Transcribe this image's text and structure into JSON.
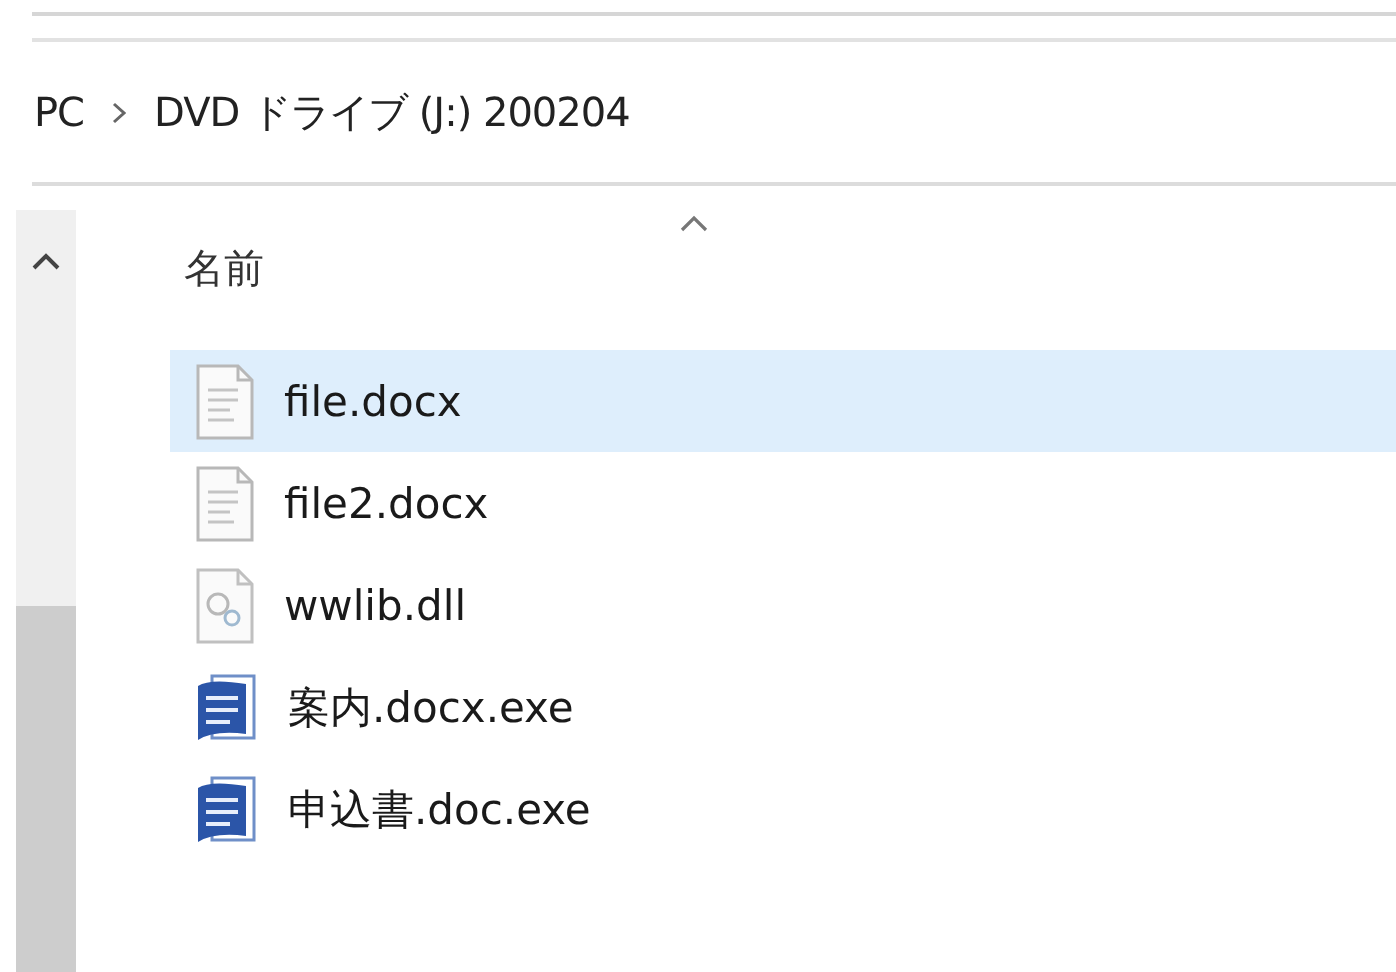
{
  "breadcrumb": [
    "PC",
    "DVD ドライブ (J:) 200204"
  ],
  "column": {
    "label": "名前",
    "sort_ascending": true
  },
  "files": [
    {
      "name": "file.docx",
      "kind": "document",
      "selected": true
    },
    {
      "name": "file2.docx",
      "kind": "document",
      "selected": false
    },
    {
      "name": "wwlib.dll",
      "kind": "library",
      "selected": false
    },
    {
      "name": "案内.docx.exe",
      "kind": "word",
      "selected": false
    },
    {
      "name": "申込書.doc.exe",
      "kind": "word",
      "selected": false
    }
  ]
}
